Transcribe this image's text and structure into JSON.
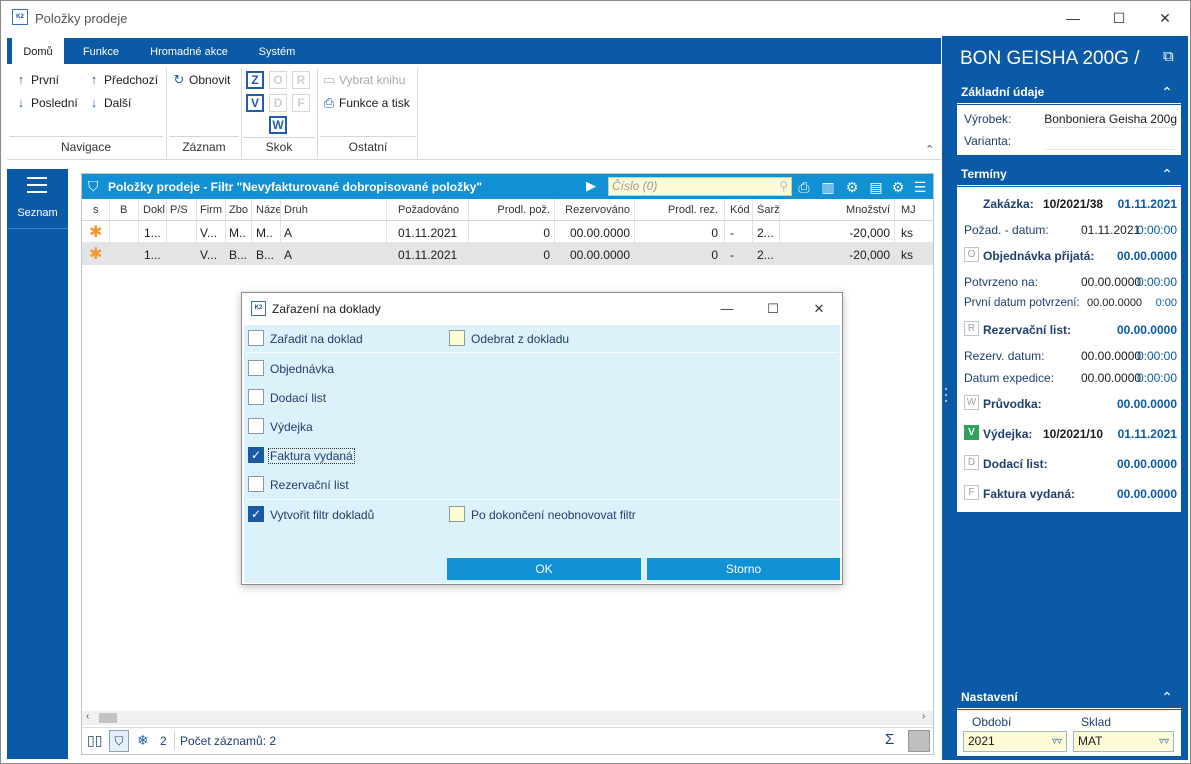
{
  "window": {
    "title": "Položky prodeje",
    "app_icon": "K2",
    "controls": [
      "—",
      "☐",
      "✕"
    ]
  },
  "ribbon": {
    "tabs": [
      {
        "label": "Domů",
        "active": true
      },
      {
        "label": "Funkce",
        "active": false
      },
      {
        "label": "Hromadné akce",
        "active": false
      },
      {
        "label": "Systém",
        "active": false
      }
    ],
    "navigace": {
      "first": "První",
      "last": "Poslední",
      "prev": "Předchozí",
      "next": "Další",
      "group_label": "Navigace"
    },
    "zaznam": {
      "refresh": "Obnovit",
      "group_label": "Záznam"
    },
    "skok": {
      "group_label": "Skok",
      "letters": [
        {
          "letter": "Z",
          "enabled": true
        },
        {
          "letter": "O",
          "enabled": false
        },
        {
          "letter": "R",
          "enabled": false
        },
        {
          "letter": "V",
          "enabled": true
        },
        {
          "letter": "D",
          "enabled": false
        },
        {
          "letter": "F",
          "enabled": false
        },
        {
          "letter": "W",
          "enabled": true
        }
      ]
    },
    "ostatni": {
      "select_book": "Vybrat knihu",
      "functions_print": "Funkce a tisk",
      "group_label": "Ostatní"
    }
  },
  "left_strip": {
    "seznam_label": "Seznam"
  },
  "grid": {
    "title": "Položky prodeje - Filtr \"Nevyfakturované dobropisované položky\"",
    "search_placeholder": "Číslo (0)",
    "columns": [
      "s",
      "B",
      "Dokl",
      "P/S",
      "Firm",
      "Zbo",
      "Náze",
      "Druh",
      "Požadováno",
      "Prodl. pož.",
      "Rezervováno",
      "Prodl. rez.",
      "Kód",
      "Šarž",
      "Množství",
      "MJ"
    ],
    "rows": [
      {
        "s": "✱",
        "b": "",
        "dokl": "1...",
        "ps": "",
        "firm": "V...",
        "zbo": "M..",
        "naz": "M..",
        "druh": "A",
        "pozadovano": "01.11.2021",
        "prodl_poz": "0",
        "rezervovano": "00.00.0000",
        "prodl_rez": "0",
        "kod": "-",
        "sarze": "2...",
        "mnozstvi": "-20,000",
        "mj": "ks",
        "selected": false
      },
      {
        "s": "✱",
        "b": "",
        "dokl": "1...",
        "ps": "",
        "firm": "V...",
        "zbo": "B...",
        "naz": "B...",
        "druh": "A",
        "pozadovano": "01.11.2021",
        "prodl_poz": "0",
        "rezervovano": "00.00.0000",
        "prodl_rez": "0",
        "kod": "-",
        "sarze": "2...",
        "mnozstvi": "-20,000",
        "mj": "ks",
        "selected": true
      }
    ],
    "status": {
      "filter_count": "2",
      "record_count": "Počet záznamů: 2"
    }
  },
  "dialog": {
    "title": "Zařazení na doklady",
    "checkboxes": {
      "zaradit": {
        "label": "Zařadit na doklad",
        "checked": false
      },
      "odebrat": {
        "label": "Odebrat z dokladu",
        "checked": false
      },
      "objednavka": {
        "label": "Objednávka",
        "checked": false
      },
      "dodaci": {
        "label": "Dodací list",
        "checked": false
      },
      "vydejka": {
        "label": "Výdejka",
        "checked": false
      },
      "faktura": {
        "label": "Faktura vydaná",
        "checked": true
      },
      "rezervacni": {
        "label": "Rezervační list",
        "checked": false
      },
      "vytvorit_filtr": {
        "label": "Vytvořit filtr dokladů",
        "checked": true
      },
      "neobnovovat": {
        "label": "Po dokončení neobnovovat filtr",
        "checked": false
      }
    },
    "ok": "OK",
    "cancel": "Storno"
  },
  "right_panel": {
    "title": "BON GEISHA 200G /",
    "zakladni": {
      "header": "Základní údaje",
      "vyrobek_label": "Výrobek:",
      "vyrobek_value": "Bonboniera Geisha 200g",
      "varianta_label": "Varianta:"
    },
    "terminy": {
      "header": "Termíny",
      "zakazka_label": "Zakázka:",
      "zakazka_doc": "10/2021/38",
      "zakazka_date": "01.11.2021",
      "pozad_label": "Požad. - datum:",
      "pozad_date": "01.11.2021",
      "pozad_time": "0:00:00",
      "obj_badge": "O",
      "obj_label": "Objednávka přijatá:",
      "obj_date": "00.00.0000",
      "potvrzeno_label": "Potvrzeno na:",
      "potvrzeno_date": "00.00.0000",
      "potvrzeno_time": "0:00:00",
      "prvni_label": "První datum potvrzení:",
      "prvni_date": "00.00.0000",
      "prvni_time": "0:00",
      "rez_badge": "R",
      "rez_label": "Rezervační list:",
      "rez_date": "00.00.0000",
      "rezdatum_label": "Rezerv. datum:",
      "rezdatum_date": "00.00.0000",
      "rezdatum_time": "0:00:00",
      "expedice_label": "Datum expedice:",
      "expedice_date": "00.00.0000",
      "expedice_time": "0:00:00",
      "pruv_badge": "W",
      "pruv_label": "Průvodka:",
      "pruv_date": "00.00.0000",
      "vyd_badge": "V",
      "vyd_label": "Výdejka:",
      "vyd_doc": "10/2021/10",
      "vyd_date": "01.11.2021",
      "dod_badge": "D",
      "dod_label": "Dodací list:",
      "dod_date": "00.00.0000",
      "fak_badge": "F",
      "fak_label": "Faktura vydaná:",
      "fak_date": "00.00.0000"
    },
    "nastaveni": {
      "header": "Nastavení",
      "obdobi_label": "Období",
      "obdobi_value": "2021",
      "sklad_label": "Sklad",
      "sklad_value": "MAT"
    }
  },
  "colors": {
    "accent_dark": "#0a5aa8",
    "accent_light": "#1190d4",
    "dialog_bg": "#dcf2fb",
    "input_bg": "#fffbd6",
    "star": "#f29a2e",
    "badge_green": "#2fa35a"
  },
  "icons": [
    "app-logo-icon",
    "minimize-icon",
    "maximize-icon",
    "close-icon",
    "arrow-up-icon",
    "arrow-down-icon",
    "refresh-icon",
    "book-icon",
    "printer-icon",
    "hamburger-icon",
    "filter-icon",
    "search-icon",
    "gear-icon",
    "chevron-up-icon",
    "external-link-icon",
    "sigma-icon",
    "snowflake-icon",
    "checkmark-icon"
  ]
}
